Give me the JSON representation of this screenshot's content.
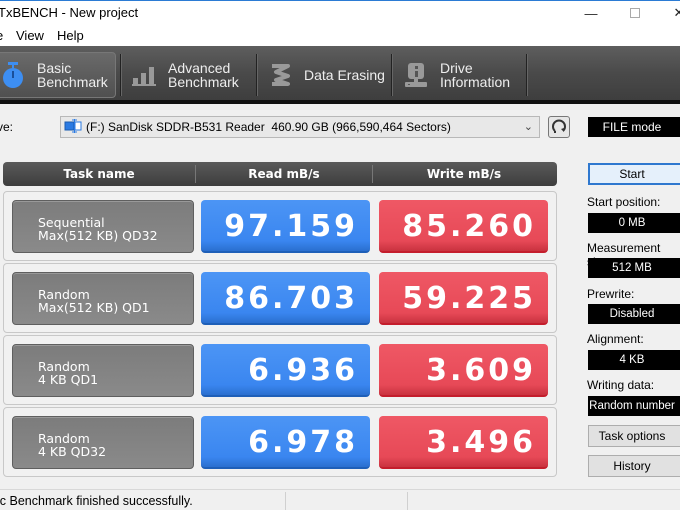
{
  "window": {
    "title": "TxBENCH - New project",
    "minimize_glyph": "—",
    "close_glyph": "✕"
  },
  "menu": {
    "items": [
      {
        "label": "e"
      },
      {
        "label": "View"
      },
      {
        "label": "Help"
      }
    ]
  },
  "toolbar": {
    "tabs": [
      {
        "line1": "Basic",
        "line2": "Benchmark",
        "icon": "stopwatch-icon",
        "active": true
      },
      {
        "line1": "Advanced",
        "line2": "Benchmark",
        "icon": "bar-chart-icon",
        "active": false
      },
      {
        "line1": "Data Erasing",
        "line2": "",
        "icon": "eraser-icon",
        "active": false
      },
      {
        "line1": "Drive",
        "line2": "Information",
        "icon": "drive-info-icon",
        "active": false
      }
    ]
  },
  "drive": {
    "label": "ve:",
    "selected": "(F:) SanDisk SDDR-B531 Reader  460.90 GB (966,590,464 Sectors)",
    "mode": "FILE mode"
  },
  "table": {
    "headers": [
      "Task name",
      "Read mB/s",
      "Write mB/s"
    ],
    "rows": [
      {
        "line1": "Sequential",
        "line2": "Max(512 KB) QD32",
        "read": "97.159",
        "write": "85.260"
      },
      {
        "line1": "Random",
        "line2": "Max(512 KB) QD1",
        "read": "86.703",
        "write": "59.225"
      },
      {
        "line1": "Random",
        "line2": "4 KB QD1",
        "read": "6.936",
        "write": "3.609"
      },
      {
        "line1": "Random",
        "line2": "4 KB QD32",
        "read": "6.978",
        "write": "3.496"
      }
    ]
  },
  "panel": {
    "start_label": "Start",
    "start_position_label": "Start position:",
    "start_position": "0 MB",
    "measurement_size_label": "Measurement size:",
    "measurement_size": "512 MB",
    "prewrite_label": "Prewrite:",
    "prewrite": "Disabled",
    "alignment_label": "Alignment:",
    "alignment": "4 KB",
    "writing_data_label": "Writing data:",
    "writing_data": "Random number",
    "task_options_label": "Task options",
    "history_label": "History"
  },
  "status": {
    "message": "ic Benchmark finished successfully."
  },
  "colors": {
    "read": "#3a86f0",
    "write": "#e74957",
    "accent": "#2f78cf"
  }
}
